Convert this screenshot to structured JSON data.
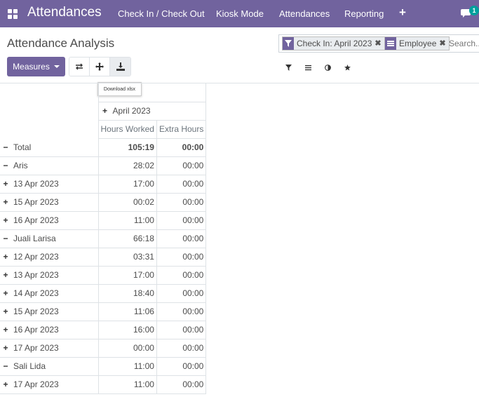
{
  "navbar": {
    "app_title": "Attendances",
    "menu": [
      "Check In / Check Out",
      "Kiosk Mode",
      "Attendances",
      "Reporting"
    ],
    "plus": "+",
    "chat_badge": "1",
    "color": "#71639e"
  },
  "control_panel": {
    "title": "Attendance Analysis",
    "facets": [
      {
        "icon": "filter-icon",
        "label": "Check In: April 2023",
        "close": "✖"
      },
      {
        "icon": "group-by-icon",
        "label": "Employee",
        "close": "✖"
      }
    ],
    "search_placeholder": "Search...",
    "measures_label": "Measures",
    "tooltip": "Download xlsx"
  },
  "pivot": {
    "col_group": "April 2023",
    "col_group_sign": "+",
    "measures": [
      "Hours Worked",
      "Extra Hours"
    ],
    "rows": [
      {
        "sign": "−",
        "label": "Total",
        "level": 1,
        "hours": "105:19",
        "extra": "00:00",
        "total": true
      },
      {
        "sign": "−",
        "label": "Aris",
        "level": 2,
        "hours": "28:02",
        "extra": "00:00"
      },
      {
        "sign": "+",
        "label": "13 Apr 2023",
        "level": 3,
        "hours": "17:00",
        "extra": "00:00"
      },
      {
        "sign": "+",
        "label": "15 Apr 2023",
        "level": 3,
        "hours": "00:02",
        "extra": "00:00"
      },
      {
        "sign": "+",
        "label": "16 Apr 2023",
        "level": 3,
        "hours": "11:00",
        "extra": "00:00"
      },
      {
        "sign": "−",
        "label": "Juali Larisa",
        "level": 2,
        "hours": "66:18",
        "extra": "00:00"
      },
      {
        "sign": "+",
        "label": "12 Apr 2023",
        "level": 3,
        "hours": "03:31",
        "extra": "00:00"
      },
      {
        "sign": "+",
        "label": "13 Apr 2023",
        "level": 3,
        "hours": "17:00",
        "extra": "00:00"
      },
      {
        "sign": "+",
        "label": "14 Apr 2023",
        "level": 3,
        "hours": "18:40",
        "extra": "00:00"
      },
      {
        "sign": "+",
        "label": "15 Apr 2023",
        "level": 3,
        "hours": "11:06",
        "extra": "00:00"
      },
      {
        "sign": "+",
        "label": "16 Apr 2023",
        "level": 3,
        "hours": "16:00",
        "extra": "00:00"
      },
      {
        "sign": "+",
        "label": "17 Apr 2023",
        "level": 3,
        "hours": "00:00",
        "extra": "00:00"
      },
      {
        "sign": "−",
        "label": "Sali Lida",
        "level": 2,
        "hours": "11:00",
        "extra": "00:00"
      },
      {
        "sign": "+",
        "label": "17 Apr 2023",
        "level": 3,
        "hours": "11:00",
        "extra": "00:00"
      }
    ]
  }
}
